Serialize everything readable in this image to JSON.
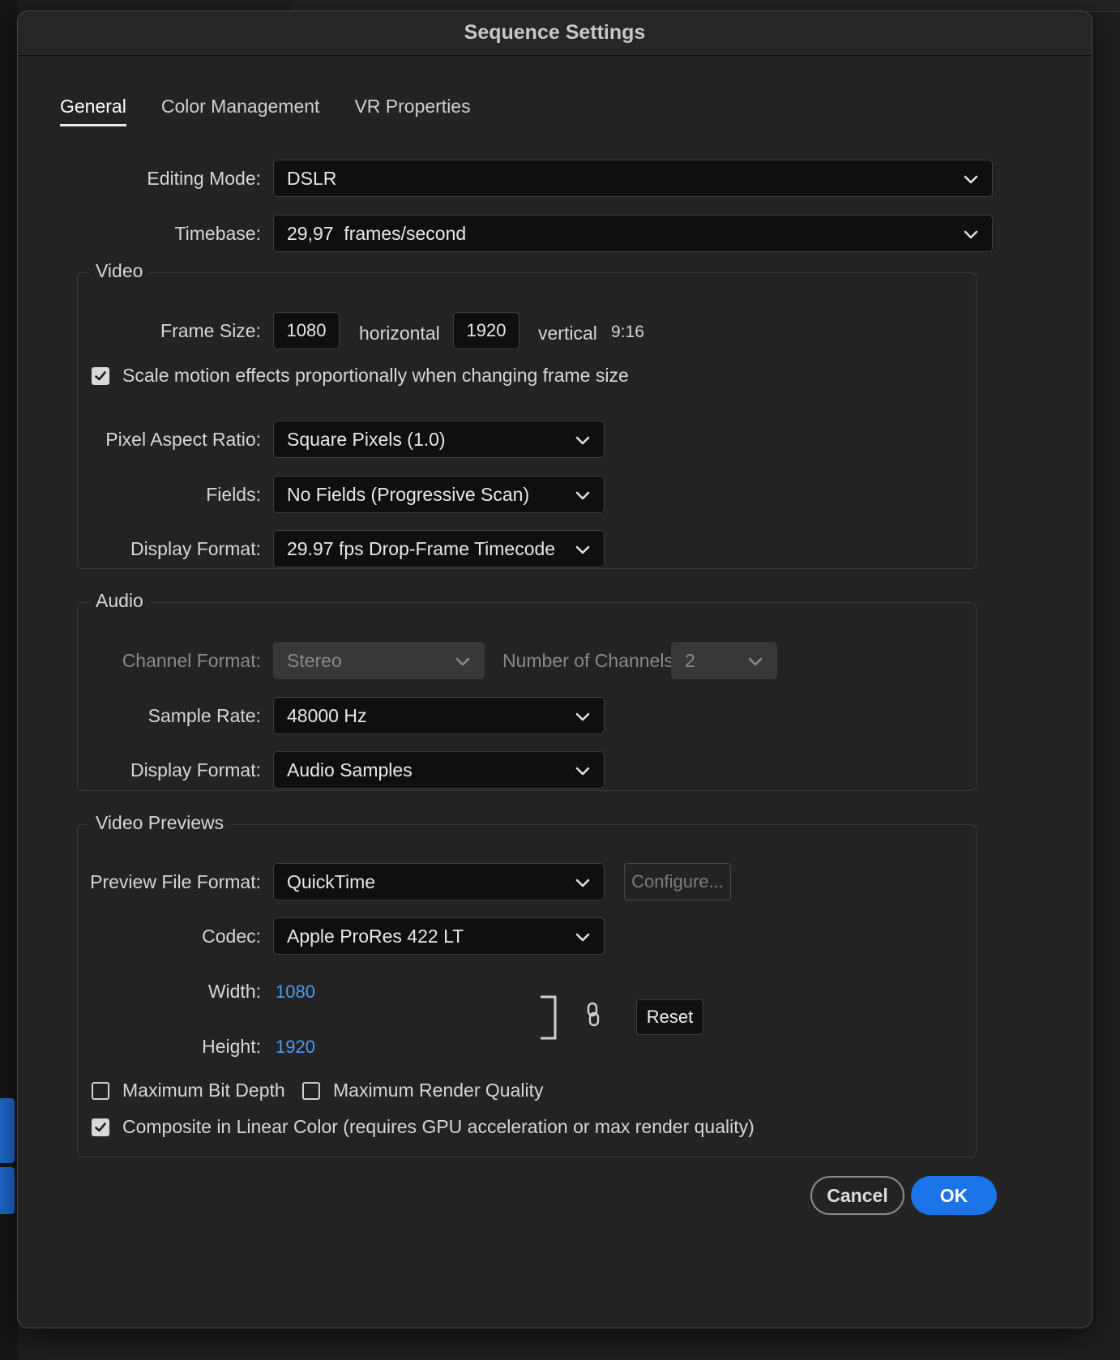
{
  "dialog": {
    "title": "Sequence Settings"
  },
  "tabs": [
    {
      "label": "General",
      "active": true
    },
    {
      "label": "Color Management"
    },
    {
      "label": "VR Properties"
    }
  ],
  "general": {
    "editing_mode": {
      "label": "Editing Mode:",
      "value": "DSLR"
    },
    "timebase": {
      "label": "Timebase:",
      "value": "29,97  frames/second"
    }
  },
  "video": {
    "title": "Video",
    "frame_size": {
      "label": "Frame Size:",
      "horizontal": "1080",
      "horizontal_label": "horizontal",
      "vertical": "1920",
      "vertical_label": "vertical",
      "ratio": "9:16"
    },
    "scale_motion": {
      "label": "Scale motion effects proportionally when changing frame size",
      "checked": true
    },
    "pixel_aspect_ratio": {
      "label": "Pixel Aspect Ratio:",
      "value": "Square Pixels (1.0)"
    },
    "fields": {
      "label": "Fields:",
      "value": "No Fields (Progressive Scan)"
    },
    "display_format": {
      "label": "Display Format:",
      "value": "29.97 fps Drop-Frame Timecode"
    }
  },
  "audio": {
    "title": "Audio",
    "channel_format": {
      "label": "Channel Format:",
      "value": "Stereo"
    },
    "num_channels": {
      "label": "Number of Channels:",
      "value": "2"
    },
    "sample_rate": {
      "label": "Sample Rate:",
      "value": "48000 Hz"
    },
    "display_format": {
      "label": "Display Format:",
      "value": "Audio Samples"
    }
  },
  "previews": {
    "title": "Video Previews",
    "file_format": {
      "label": "Preview File Format:",
      "value": "QuickTime"
    },
    "configure_label": "Configure...",
    "codec": {
      "label": "Codec:",
      "value": "Apple ProRes 422 LT"
    },
    "width": {
      "label": "Width:",
      "value": "1080"
    },
    "height": {
      "label": "Height:",
      "value": "1920"
    },
    "reset_label": "Reset",
    "max_bit_depth": {
      "label": "Maximum Bit Depth",
      "checked": false
    },
    "max_render_quality": {
      "label": "Maximum Render Quality",
      "checked": false
    },
    "composite_linear": {
      "label": "Composite in Linear Color (requires GPU acceleration or max render quality)",
      "checked": true
    }
  },
  "buttons": {
    "cancel": "Cancel",
    "ok": "OK"
  },
  "colors": {
    "accent": "#1a73e8",
    "link_value": "#4a9cf2"
  }
}
